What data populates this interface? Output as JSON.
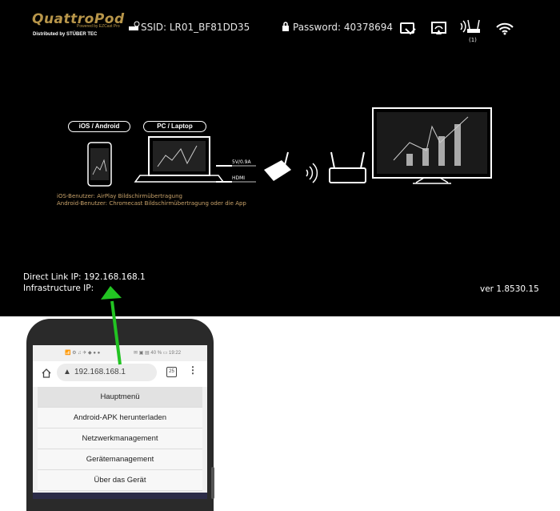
{
  "header": {
    "logo": "QuattroPod",
    "logo_tagline": "Powered by EZCast Pro",
    "distributor": "Distributed by STÜBER TEC",
    "ssid": "SSID: LR01_BF81DD35",
    "password": "Password: 40378694",
    "connected_count": "(1)"
  },
  "diagram": {
    "tag_mobile": "iOS / Android",
    "tag_pc": "PC / Laptop",
    "power_label": "5V/0.9A",
    "hdmi_label": "HDMI",
    "ios_note": "iOS-Benutzer: AirPlay Bildschirmübertragung",
    "android_note": "Android-Benutzer: Chromecast Bildschirmübertragung oder die App"
  },
  "footer": {
    "direct_link": "Direct Link IP: 192.168.168.1",
    "infrastructure": "Infrastructure IP:",
    "version": "ver 1.8530.15"
  },
  "phone": {
    "status_left": "📶 ⚙ ♫ ✈ ◆ ● ●",
    "status_right": "✉ ▣ ▤ 40 % ▭ 19:22",
    "url": "192.168.168.1",
    "tabs_count": "25",
    "menu": [
      "Hauptmenü",
      "Android-APK herunterladen",
      "Netzwerkmanagement",
      "Gerätemanagement",
      "Über das Gerät"
    ]
  },
  "colors": {
    "accent_gold": "#b8964a",
    "arrow_green": "#22c322",
    "background": "#000000"
  }
}
